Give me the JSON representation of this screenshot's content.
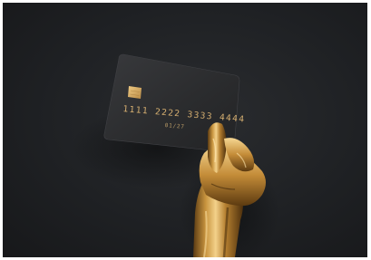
{
  "card": {
    "number": "1111 2222 3333 4444",
    "expiry": "01/27"
  },
  "colors": {
    "background": "#1f2124",
    "card": "#2b2c2e",
    "gold_light": "#f3d18a",
    "gold_mid": "#c8943e",
    "gold_dark": "#6a4416",
    "print": "#d7b071"
  },
  "icons": [
    "chip-icon"
  ]
}
